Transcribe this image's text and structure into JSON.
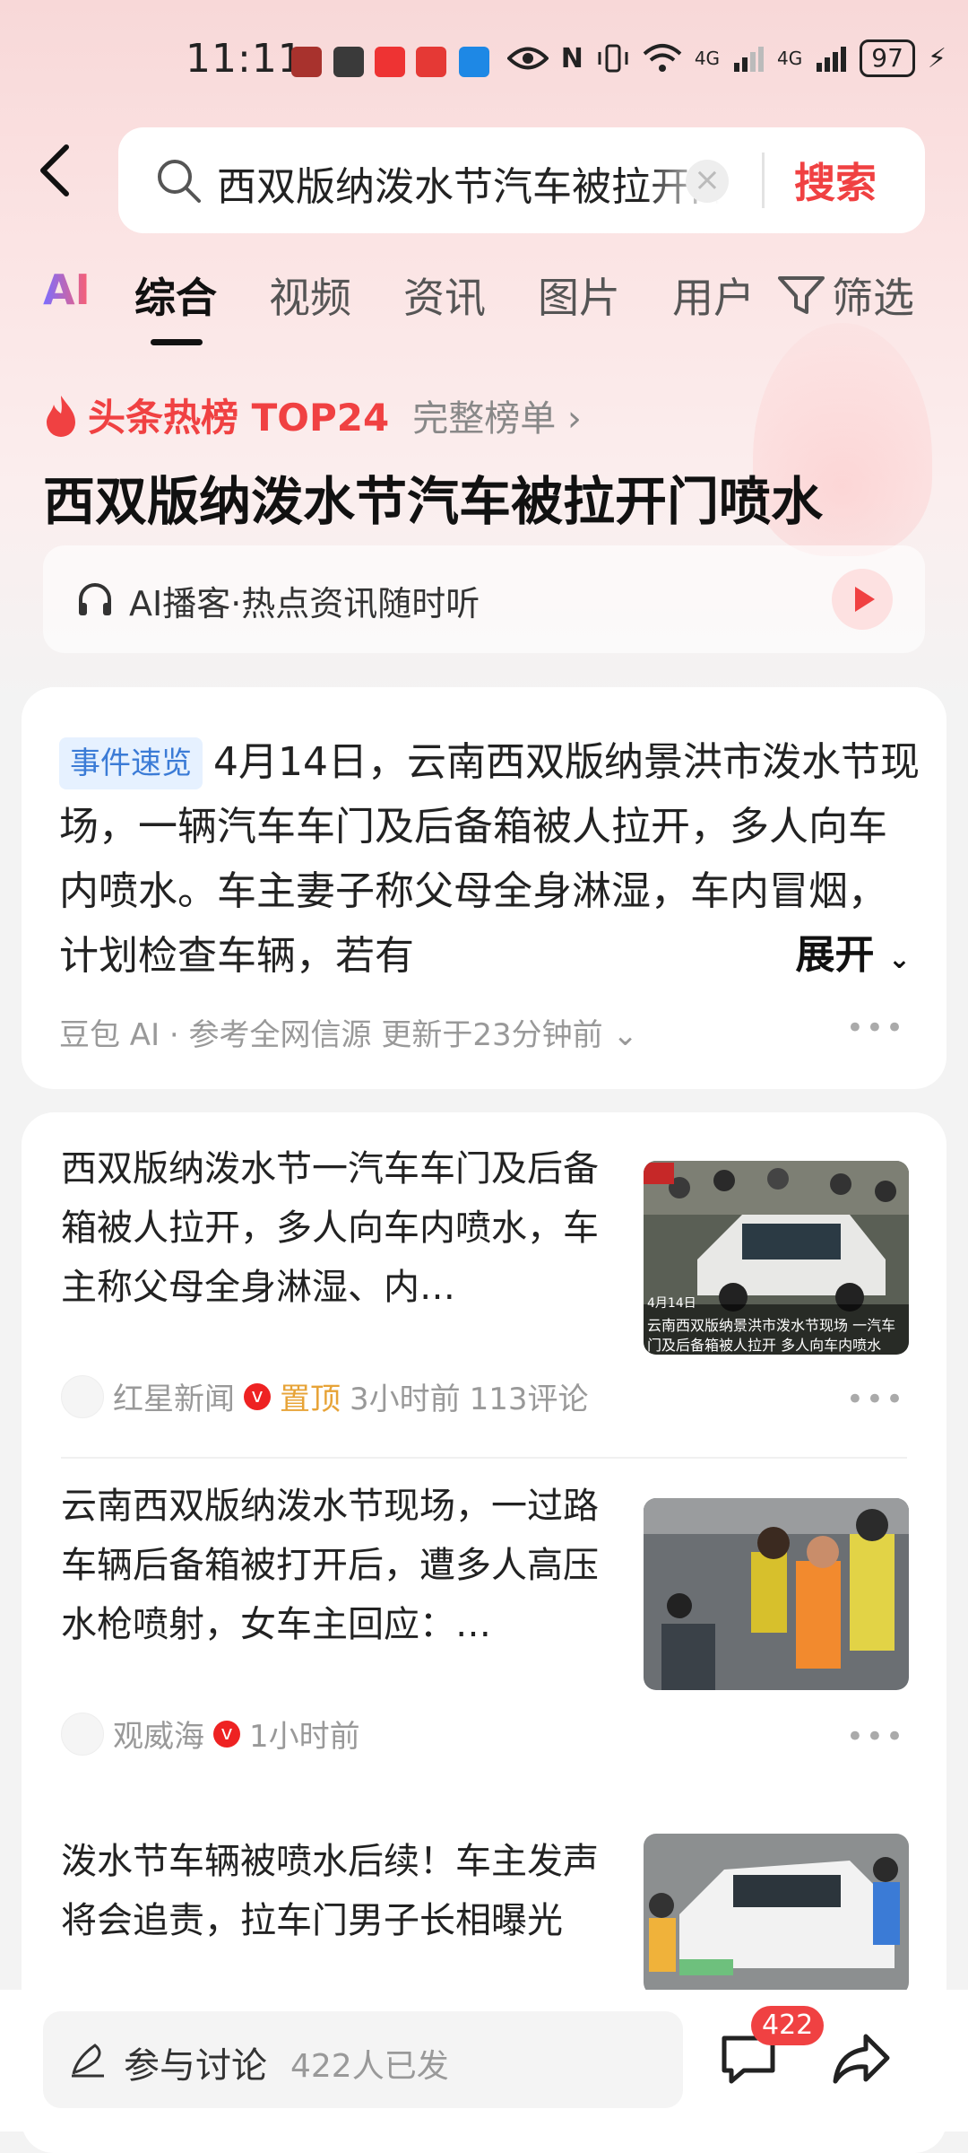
{
  "status_bar": {
    "time": "11:11",
    "network_1": "4G",
    "network_2": "4G",
    "battery": "97"
  },
  "search": {
    "query": "西双版纳泼水节汽车被拉开门喷水",
    "button_label": "搜索",
    "clear_icon": "close-icon"
  },
  "tabs": {
    "items": [
      {
        "label": "AI"
      },
      {
        "label": "综合"
      },
      {
        "label": "视频"
      },
      {
        "label": "资讯"
      },
      {
        "label": "图片"
      },
      {
        "label": "用户"
      }
    ],
    "active": "综合",
    "filter_label": "筛选"
  },
  "hot": {
    "label": "头条热榜 TOP24",
    "link": "完整榜单 ›",
    "title": "西双版纳泼水节汽车被拉开门喷水",
    "podcast": "AI播客·热点资讯随时听"
  },
  "summary": {
    "badge": "事件速览",
    "text": "4月14日，云南西双版纳景洪市泼水节现场，一辆汽车车门及后备箱被人拉开，多人向车内喷水。车主妻子称父母全身淋湿，车内冒烟，计划检查车辆，若有",
    "expand": "展开",
    "meta": "豆包 AI · 参考全网信源 更新于23分钟前"
  },
  "news": [
    {
      "title": "西双版纳泼水节一汽车车门及后备箱被人拉开，多人向车内喷水，车主称父母全身淋湿、内…",
      "source": "红星新闻",
      "pinned": "置顶",
      "time": "3小时前",
      "comments": "113评论",
      "image_caption_1": "云南西双版纳景洪市泼水节现场 一汽车",
      "image_caption_2": "门及后备箱被人拉开 多人向车内喷水",
      "image_date": "4月14日"
    },
    {
      "title": "云南西双版纳泼水节现场，一过路车辆后备箱被打开后，遭多人高压水枪喷射，女车主回应：…",
      "source": "观威海",
      "time": "1小时前"
    },
    {
      "title": "泼水节车辆被喷水后续！车主发声将会追责，拉车门男子长相曝光"
    }
  ],
  "bottom": {
    "discuss_label": "参与讨论",
    "discuss_count": "422人已发",
    "comment_badge": "422"
  },
  "colors": {
    "accent": "#f04142",
    "badge_blue": "#3b7bd6",
    "pin_orange": "#e7a337"
  }
}
